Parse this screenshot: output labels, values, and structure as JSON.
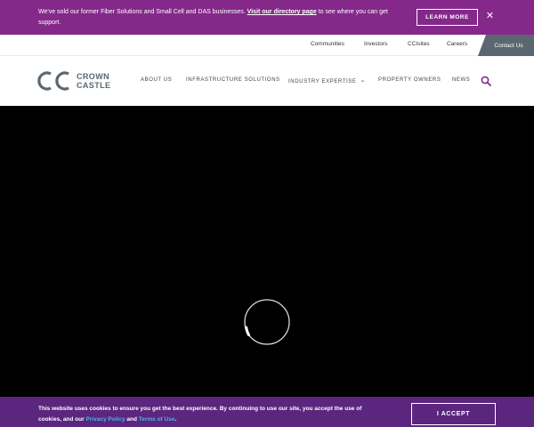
{
  "announcement": {
    "text_before": "We've sold our former Fiber Solutions and Small Cell and DAS businesses. ",
    "link": "Visit our directory page",
    "text_after": " to see where you can get support.",
    "button": "LEARN MORE",
    "close_icon": "close-icon"
  },
  "utility_nav": {
    "links": [
      "Communities",
      "Investors",
      "CCIsites",
      "Careers"
    ],
    "contact": "Contact Us"
  },
  "brand": {
    "line1": "CROWN",
    "line2": "CASTLE",
    "color": "#5b6770"
  },
  "main_nav": {
    "items": [
      "ABOUT US",
      "INFRASTRUCTURE SOLUTIONS",
      "INDUSTRY EXPERTISE",
      "PROPERTY OWNERS",
      "NEWS"
    ],
    "search_icon": "search-icon"
  },
  "cookie": {
    "text_before": "This website uses cookies to ensure you get the best experience. By continuing to use our site, you accept the use of cookies, and our ",
    "privacy": "Privacy Policy",
    "and": " and ",
    "terms": "Terms of Use",
    "text_after": ".",
    "button": "I ACCEPT"
  },
  "colors": {
    "accent_purple": "#84288a",
    "cookie_bg": "#5a267e",
    "link_blue": "#46b7e8",
    "video_bg": "#000000"
  }
}
